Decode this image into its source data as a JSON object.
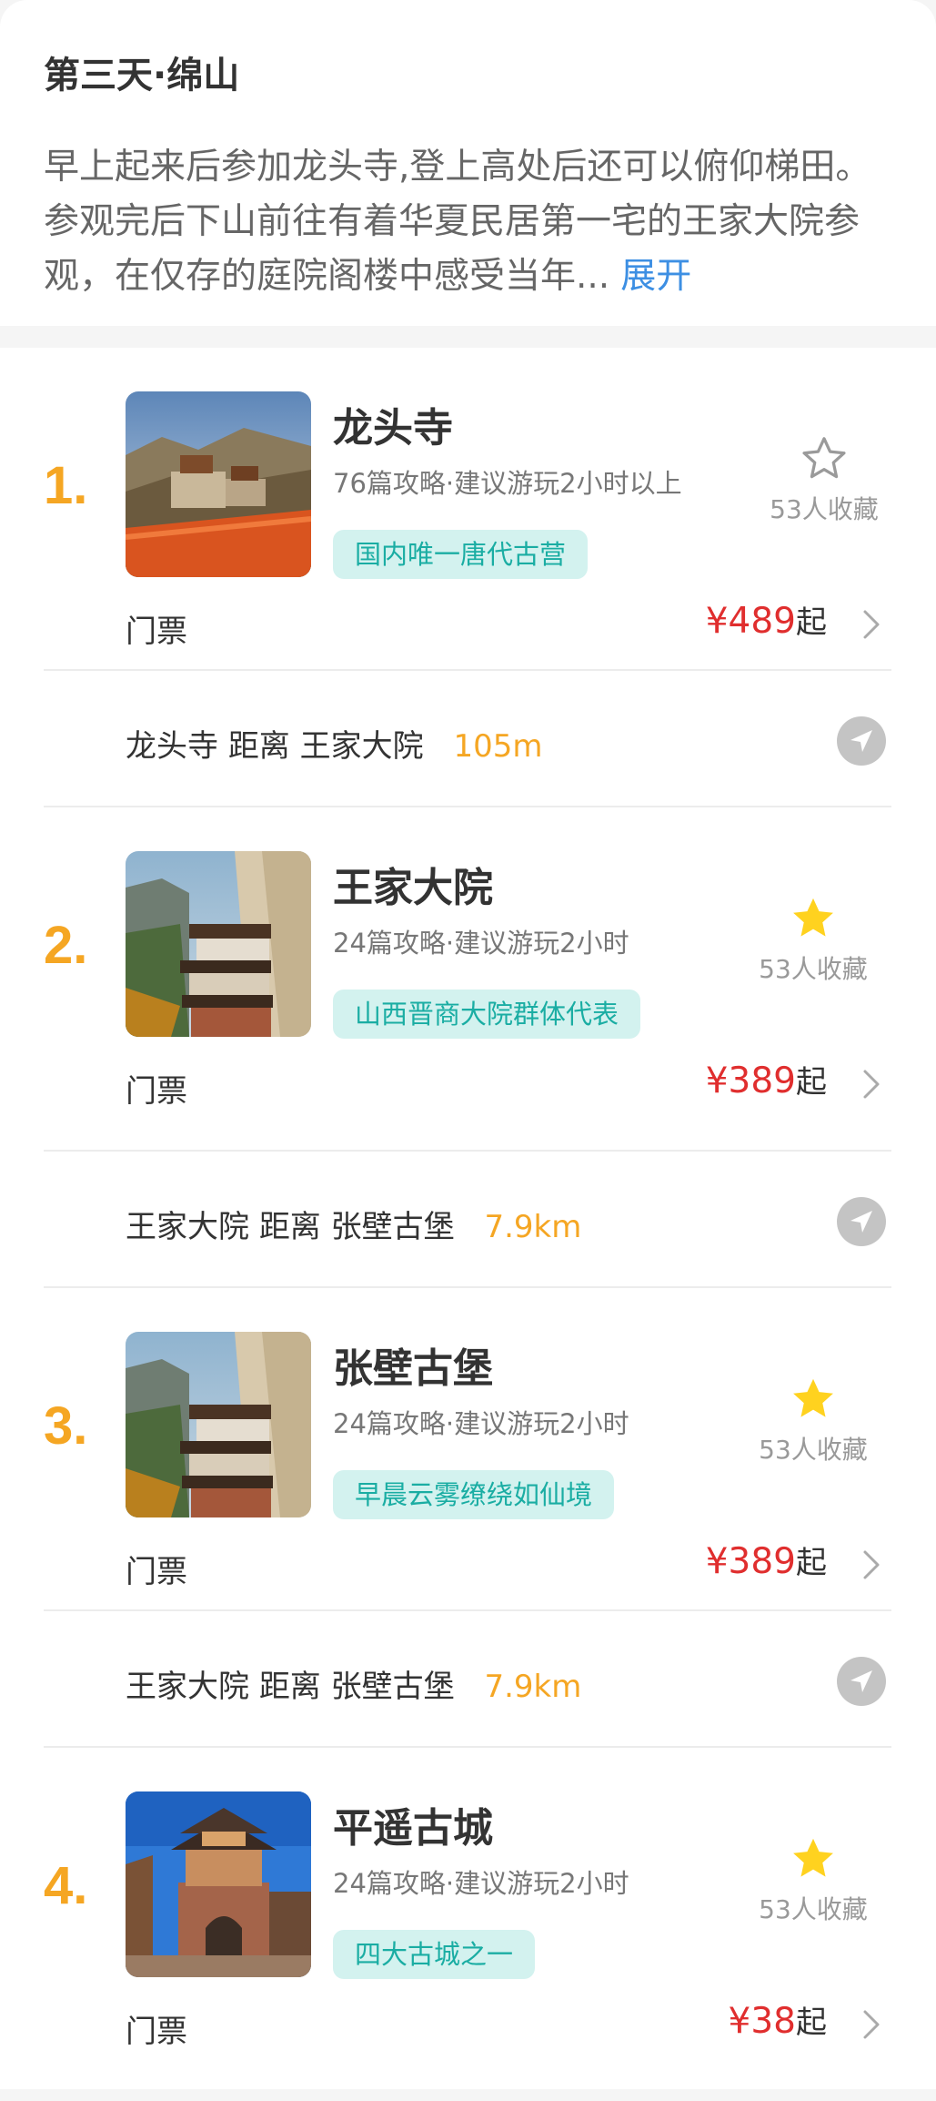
{
  "day": {
    "title": "第三天·绵山",
    "description": "早上起来后参加龙头寺,登上高处后还可以俯仰梯田。参观完后下山前往有着华夏民居第一宅的王家大院参观，在仅存的庭院阁楼中感受当年...",
    "expand_label": "展开"
  },
  "spots": [
    {
      "index": "1.",
      "name": "龙头寺",
      "meta": "76篇攻略·建议游玩2小时以上",
      "tag": "国内唯一唐代古营",
      "favorite_count": "53人收藏",
      "favorited": false,
      "ticket_label": "门票",
      "price": "¥489",
      "price_suffix": "起",
      "image": "mountain-temple-wall"
    },
    {
      "index": "2.",
      "name": "王家大院",
      "meta": "24篇攻略·建议游玩2小时",
      "tag": "山西晋商大院群体代表",
      "favorite_count": "53人收藏",
      "favorited": true,
      "ticket_label": "门票",
      "price": "¥389",
      "price_suffix": "起",
      "image": "cliff-temple"
    },
    {
      "index": "3.",
      "name": "张壁古堡",
      "meta": "24篇攻略·建议游玩2小时",
      "tag": "早晨云雾缭绕如仙境",
      "favorite_count": "53人收藏",
      "favorited": true,
      "ticket_label": "门票",
      "price": "¥389",
      "price_suffix": "起",
      "image": "cliff-temple"
    },
    {
      "index": "4.",
      "name": "平遥古城",
      "meta": "24篇攻略·建议游玩2小时",
      "tag": "四大古城之一",
      "favorite_count": "53人收藏",
      "favorited": true,
      "ticket_label": "门票",
      "price": "¥38",
      "price_suffix": "起",
      "image": "city-gate-tower"
    }
  ],
  "distances": [
    {
      "from": "龙头寺",
      "label": "距离",
      "to": "王家大院",
      "value": "105m"
    },
    {
      "from": "王家大院",
      "label": "距离",
      "to": "张壁古堡",
      "value": "7.9km"
    },
    {
      "from": "王家大院",
      "label": "距离",
      "to": "张壁古堡",
      "value": "7.9km"
    }
  ],
  "colors": {
    "accent_orange": "#f5a623",
    "price_red": "#e02e2e",
    "tag_bg": "#d3f2ef",
    "tag_text": "#1aada3",
    "link_blue": "#3d8fe3",
    "star_yellow": "#ffd21f"
  }
}
